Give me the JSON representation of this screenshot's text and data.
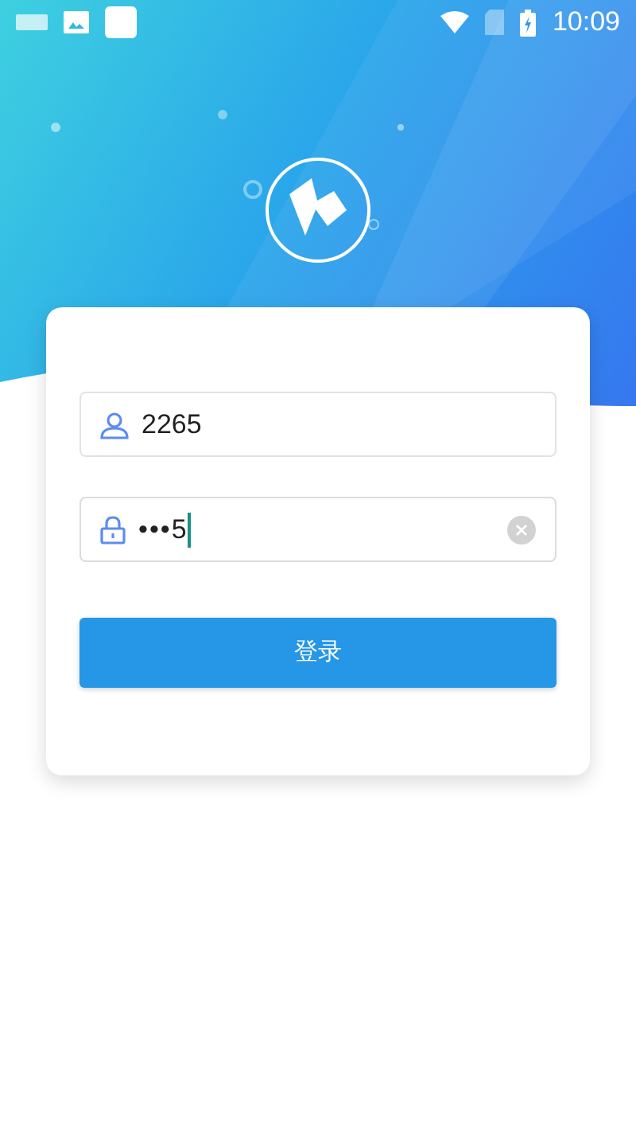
{
  "status_bar": {
    "time": "10:09"
  },
  "login_form": {
    "username": {
      "value": "2265"
    },
    "password": {
      "value": "•••5",
      "focused": true,
      "clearable": true
    },
    "submit_button": "登录"
  }
}
